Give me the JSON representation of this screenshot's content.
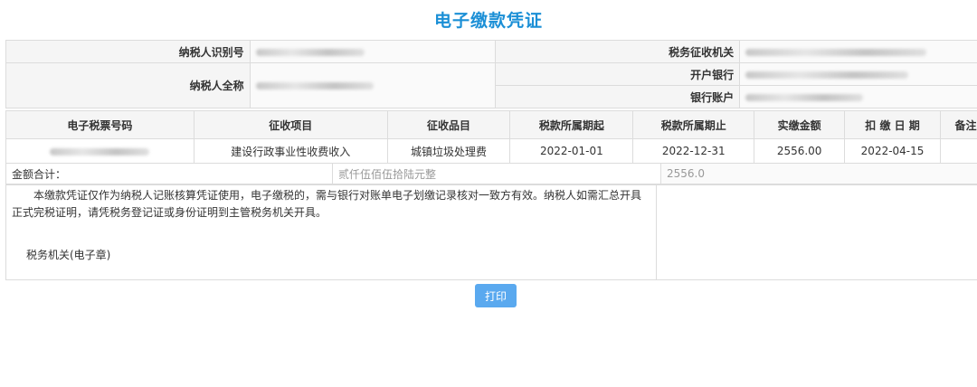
{
  "title": "电子缴款凭证",
  "info": {
    "taxpayer_id_label": "纳税人识别号",
    "taxpayer_name_label": "纳税人全称",
    "tax_authority_label": "税务征收机关",
    "bank_label": "开户银行",
    "account_label": "银行账户"
  },
  "table": {
    "headers": [
      "电子税票号码",
      "征收项目",
      "征收品目",
      "税款所属期起",
      "税款所属期止",
      "实缴金额",
      "扣 缴 日 期",
      "备注"
    ],
    "row": {
      "project": "建设行政事业性收费收入",
      "item": "城镇垃圾处理费",
      "period_start": "2022-01-01",
      "period_end": "2022-12-31",
      "amount": "2556.00",
      "deduct_date": "2022-04-15",
      "remark": ""
    }
  },
  "summary": {
    "label": "金额合计：",
    "amount_chinese": "贰仟伍佰伍拾陆元整",
    "amount_number": "2556.0"
  },
  "note": {
    "text": "本缴款凭证仅作为纳税人记账核算凭证使用，电子缴税的，需与银行对账单电子划缴记录核对一致方有效。纳税人如需汇总开具正式完税证明，请凭税务登记证或身份证明到主管税务机关开具。",
    "stamp": "税务机关(电子章)"
  },
  "print_button": "打印"
}
